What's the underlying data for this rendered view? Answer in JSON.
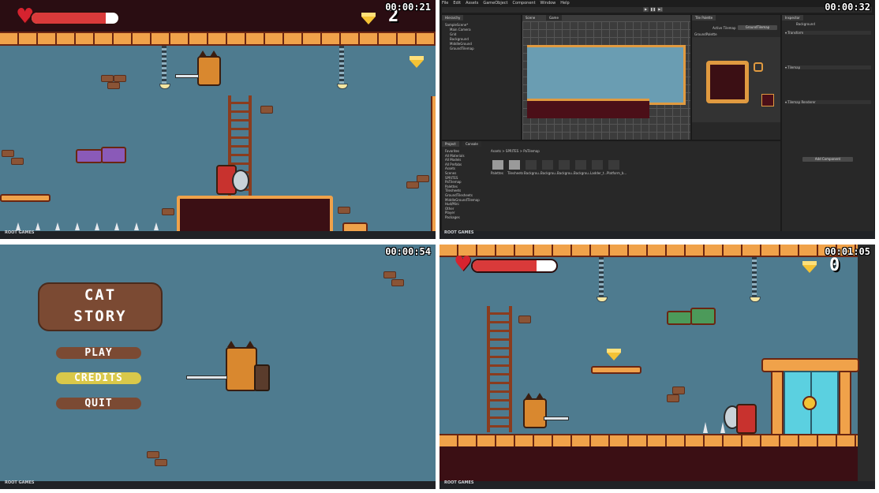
{
  "watermark": "ROOT GAMES",
  "panels": {
    "top_left": {
      "timestamp": "00:00:21",
      "gem_count": "2",
      "health_fraction": 0.85
    },
    "top_right": {
      "timestamp": "00:00:32",
      "menu": [
        "File",
        "Edit",
        "Assets",
        "GameObject",
        "Component",
        "Window",
        "Help"
      ],
      "hierarchy_title": "Hierarchy",
      "hierarchy_items": [
        "SampleScene*",
        "Main Camera",
        "Grid",
        "Background",
        "MiddleGround",
        "GroundTilemap"
      ],
      "scene_tab": "Scene",
      "game_tab": "Game",
      "palette_title": "Tile Palette",
      "active_tilemap_label": "Active Tilemap",
      "active_tilemap": "GroundTilemap",
      "palette_name": "GroundPalette",
      "inspector_title": "Inspector",
      "inspector_object": "Background",
      "inspector_sections": [
        "Transform",
        "Tilemap",
        "Tilemap Renderer"
      ],
      "add_component": "Add Component",
      "project_tab": "Project",
      "console_tab": "Console",
      "project_tree": [
        "Favorites",
        "All Materials",
        "All Models",
        "All Prefabs",
        "Assets",
        "Scenes",
        "SPRITES",
        "PaTilemap",
        "Palettes",
        "Tilesheets",
        "GroundTilesheets",
        "MiddleGroundTilemap",
        "Hud/Mini",
        "Other",
        "Player",
        "Packages"
      ],
      "breadcrumb": "Assets > SPRITES > PaTilemap",
      "assets": [
        "Palettes",
        "Tilesheets",
        "Backgrou...",
        "Backgrou...",
        "Backgrou...",
        "Backgrou...",
        "Ladder_t...",
        "Platform_b..."
      ]
    },
    "bottom_left": {
      "timestamp": "00:00:54",
      "title_line1": "CAT",
      "title_line2": "STORY",
      "menu_items": [
        "PLAY",
        "CREDITS",
        "QUIT"
      ],
      "selected": "CREDITS",
      "selected_color": "#d9c84a",
      "normal_color": "#7b4a33"
    },
    "bottom_right": {
      "timestamp": "00:01:05",
      "gem_count": "0",
      "health_fraction": 0.76
    }
  }
}
